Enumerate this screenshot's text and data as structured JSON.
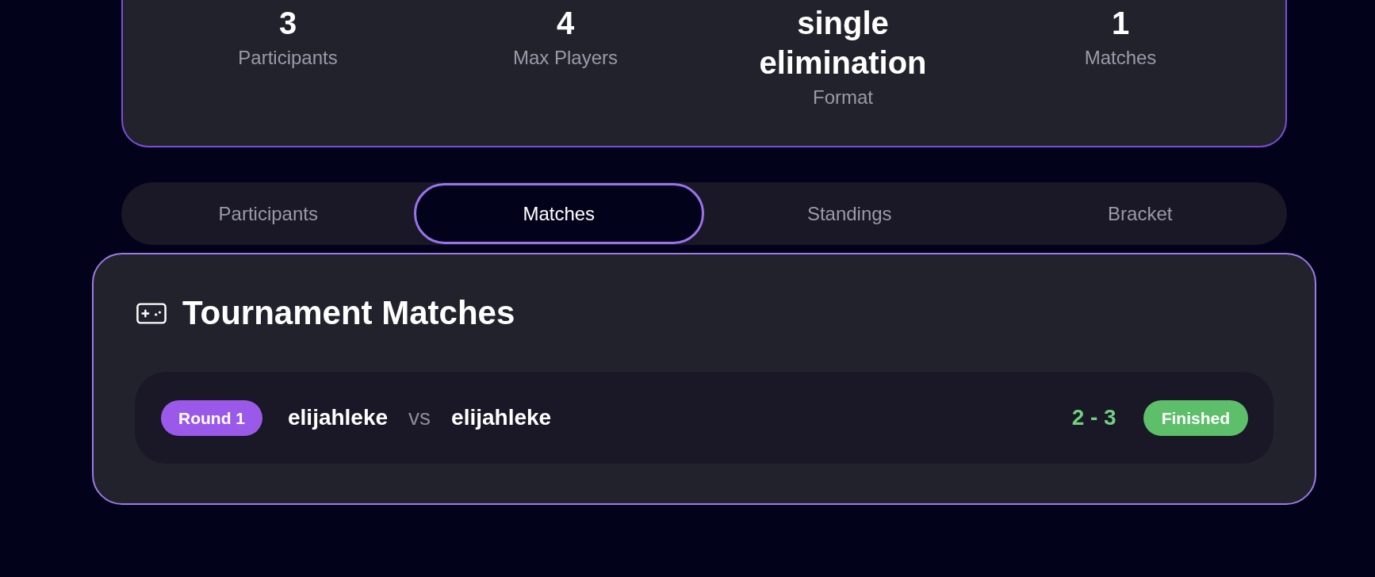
{
  "stats": [
    {
      "value": "3",
      "label": "Participants"
    },
    {
      "value": "4",
      "label": "Max Players"
    },
    {
      "value": "single elimination",
      "label": "Format"
    },
    {
      "value": "1",
      "label": "Matches"
    }
  ],
  "tabs": [
    {
      "label": "Participants",
      "selected": false
    },
    {
      "label": "Matches",
      "selected": true
    },
    {
      "label": "Standings",
      "selected": false
    },
    {
      "label": "Bracket",
      "selected": false
    }
  ],
  "matches_panel": {
    "title": "Tournament Matches",
    "matches": [
      {
        "round": "Round 1",
        "player_1": "elijahleke",
        "separator": "vs",
        "player_2": "elijahleke",
        "score": "2 - 3",
        "status": "Finished"
      }
    ]
  }
}
